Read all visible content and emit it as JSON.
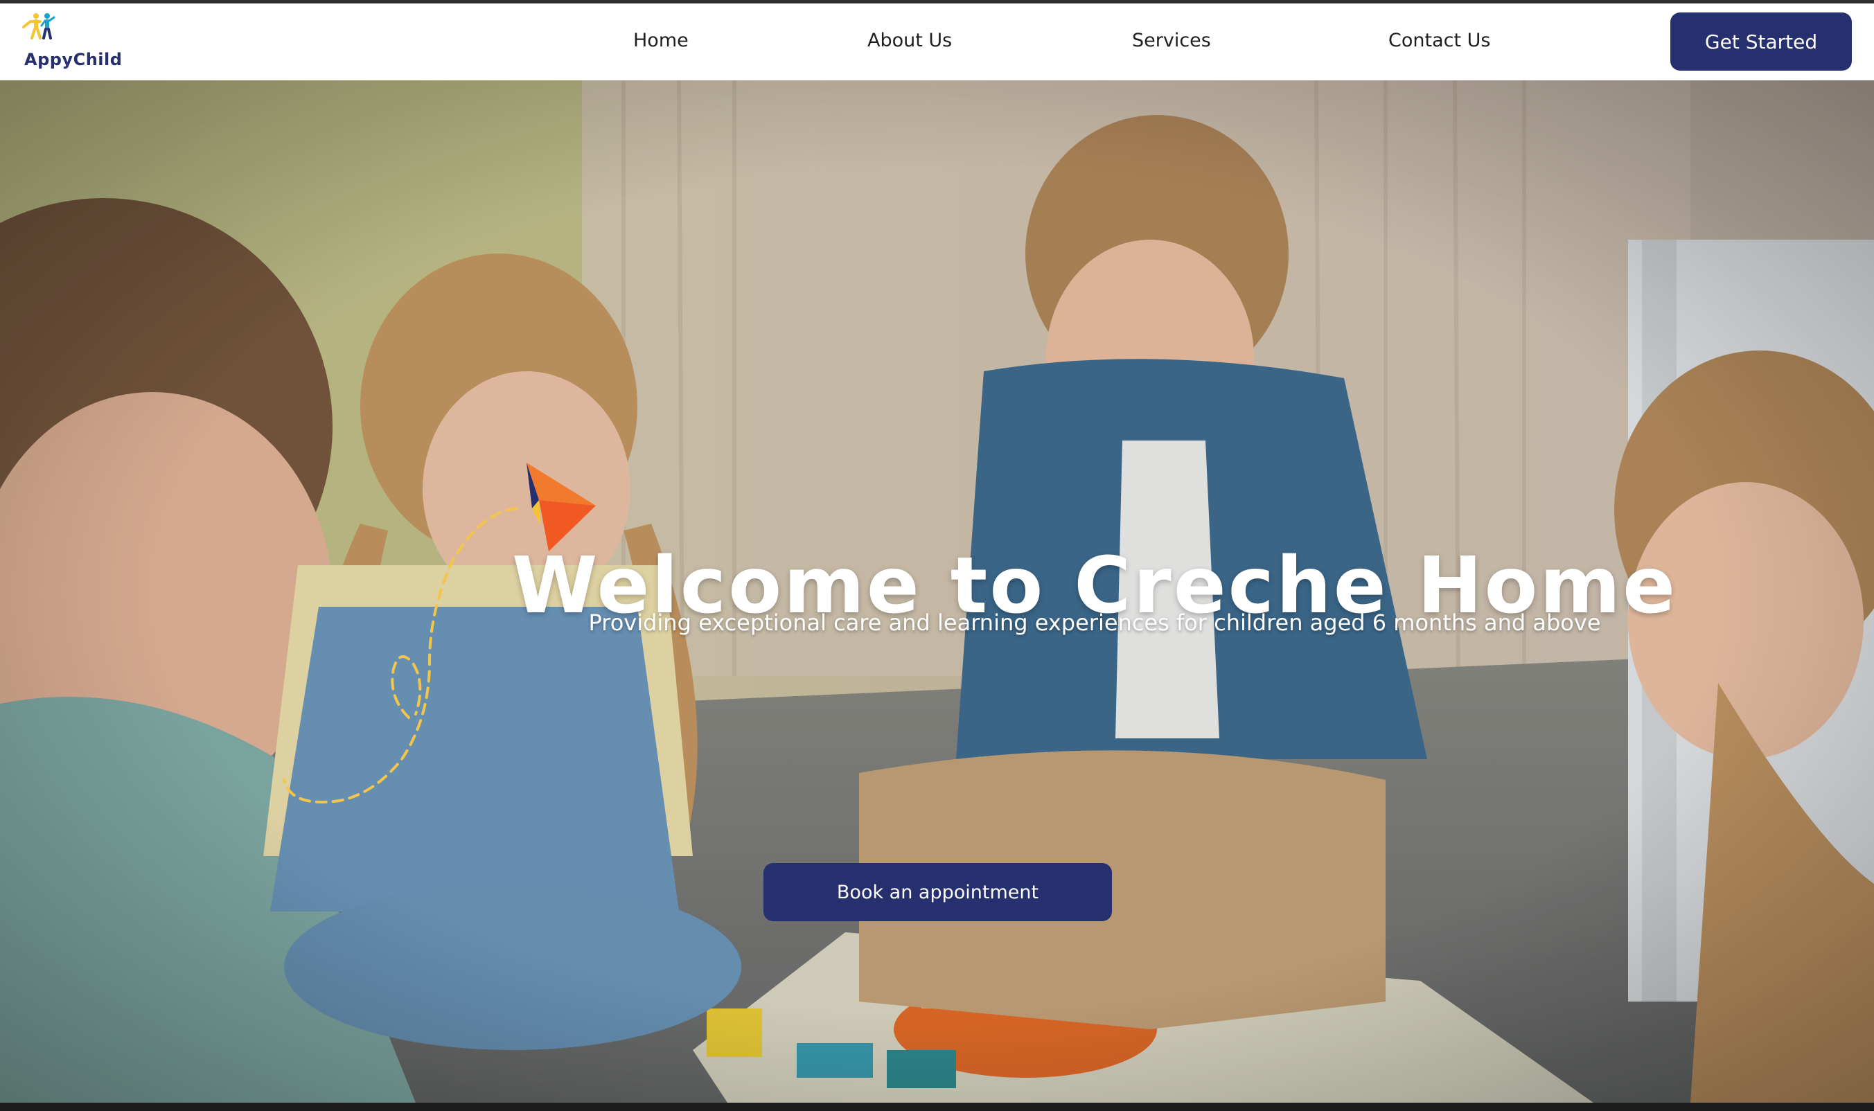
{
  "brand": {
    "name": "AppyChild"
  },
  "nav": {
    "items": [
      {
        "label": "Home"
      },
      {
        "label": "About Us"
      },
      {
        "label": "Services"
      },
      {
        "label": "Contact Us"
      }
    ],
    "cta_label": "Get Started"
  },
  "hero": {
    "title": "Welcome to Creche Home",
    "subtitle": "Providing exceptional care and learning experiences for children aged 6 months and above",
    "button_label": "Book an appointment",
    "background_image": "photo of four children playing with wooden blocks on a classroom floor"
  },
  "colors": {
    "primary": "#27306f",
    "text_dark": "#1f1f1f",
    "white": "#ffffff",
    "accent_orange": "#f27a2c",
    "accent_yellow": "#f6c531",
    "trail_yellow": "#f3c54a"
  },
  "icons": {
    "logo": "children-figures-icon",
    "decoration": "paper-plane-icon"
  }
}
